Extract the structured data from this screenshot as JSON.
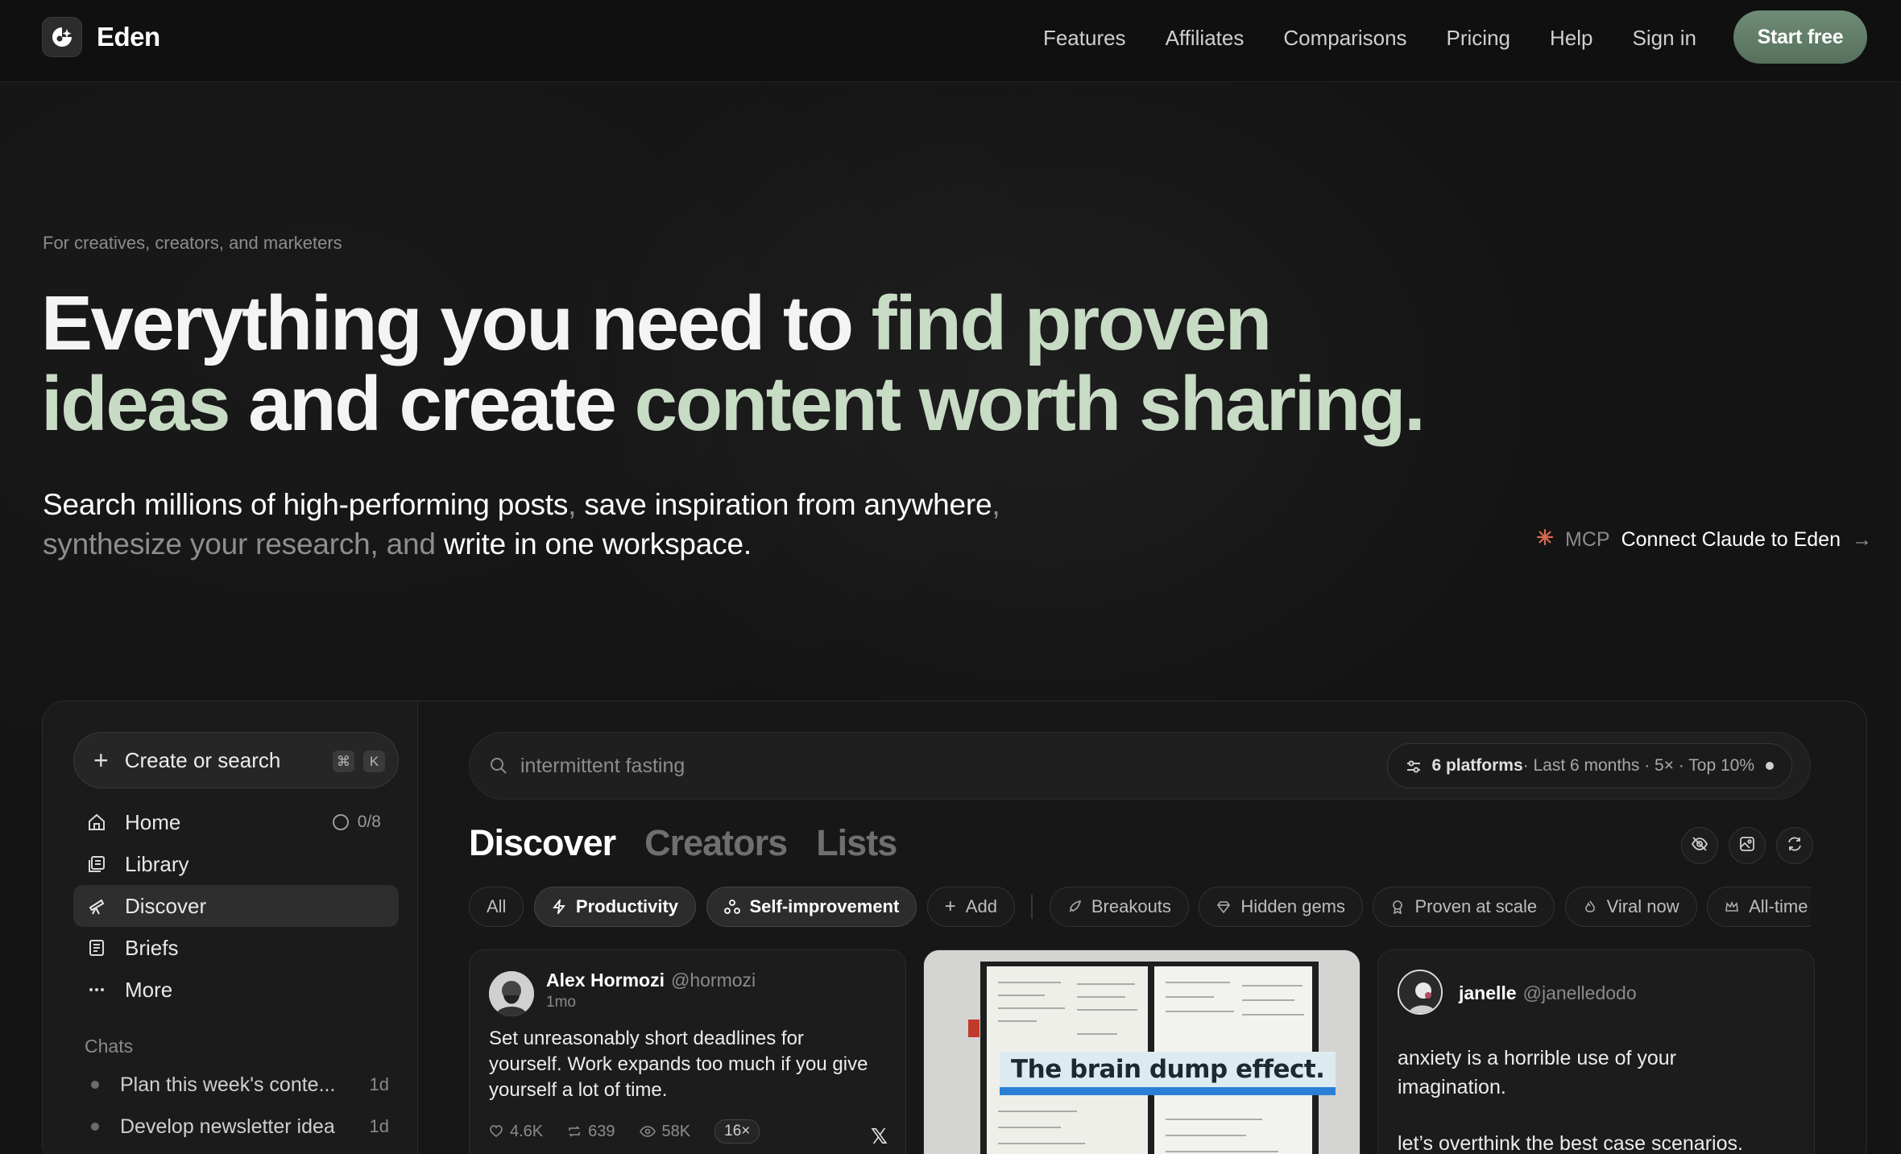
{
  "brand": {
    "name": "Eden"
  },
  "nav": {
    "links": [
      "Features",
      "Affiliates",
      "Comparisons",
      "Pricing",
      "Help",
      "Sign in"
    ],
    "cta": "Start free"
  },
  "hero": {
    "eyebrow": "For creatives, creators, and marketers",
    "headline": {
      "part1": "Everything you need to ",
      "accent1": "find proven",
      "accent2": "ideas",
      "part2": " and create ",
      "accent3": "content worth sharing."
    },
    "subheadline": {
      "s1": "Search millions of high-performing posts",
      "m1": ", ",
      "s2": "save inspiration from anywhere",
      "m2": ", synthesize your research, and ",
      "s3": "write in one workspace."
    },
    "mcp": {
      "tag": "MCP",
      "cta": "Connect Claude to Eden",
      "arrow": "→"
    }
  },
  "sidebar": {
    "create": {
      "label": "Create or search",
      "shortcut_mod": "⌘",
      "shortcut_key": "K"
    },
    "items": [
      {
        "label": "Home",
        "icon": "home-icon",
        "badge": "0/8"
      },
      {
        "label": "Library",
        "icon": "library-icon"
      },
      {
        "label": "Discover",
        "icon": "telescope-icon",
        "active": true
      },
      {
        "label": "Briefs",
        "icon": "briefs-icon"
      },
      {
        "label": "More",
        "icon": "more-icon"
      }
    ],
    "chats_title": "Chats",
    "chats": [
      {
        "title": "Plan this week's conte...",
        "time": "1d"
      },
      {
        "title": "Develop newsletter idea",
        "time": "1d"
      }
    ]
  },
  "search": {
    "value": "intermittent fasting",
    "filter": {
      "platforms": "6 platforms",
      "details": " · Last 6 months · 5× · Top 10%"
    }
  },
  "tabs": [
    "Discover",
    "Creators",
    "Lists"
  ],
  "chips": {
    "topics": [
      {
        "label": "All",
        "selected": false
      },
      {
        "label": "Productivity",
        "selected": true,
        "icon": "bolt-icon"
      },
      {
        "label": "Self-improvement",
        "selected": true,
        "icon": "nodes-icon"
      },
      {
        "label": "Add",
        "selected": false,
        "icon": "plus-icon"
      }
    ],
    "modes": [
      {
        "label": "Breakouts",
        "icon": "rocket-icon"
      },
      {
        "label": "Hidden gems",
        "icon": "gem-icon"
      },
      {
        "label": "Proven at scale",
        "icon": "award-icon"
      },
      {
        "label": "Viral now",
        "icon": "flame-icon"
      },
      {
        "label": "All-time",
        "icon": "crown-icon"
      }
    ]
  },
  "cards": [
    {
      "author": "Alex Hormozi",
      "handle": "@hormozi",
      "age": "1mo",
      "text": "Set unreasonably short deadlines for yourself. Work expands too much if you give yourself a lot of time.",
      "likes": "4.6K",
      "reposts": "639",
      "views": "58K",
      "multiplier": "16×",
      "platform": "x-icon"
    },
    {
      "overlay": "The brain dump effect."
    },
    {
      "author": "janelle",
      "handle": "@janelledodo",
      "text1": "anxiety is a horrible use of your imagination.",
      "text2": "let’s overthink the best case scenarios."
    }
  ],
  "colors": {
    "background": "#141414",
    "accent_text": "#c7dbc5",
    "cta_green": "#5f7b66"
  }
}
